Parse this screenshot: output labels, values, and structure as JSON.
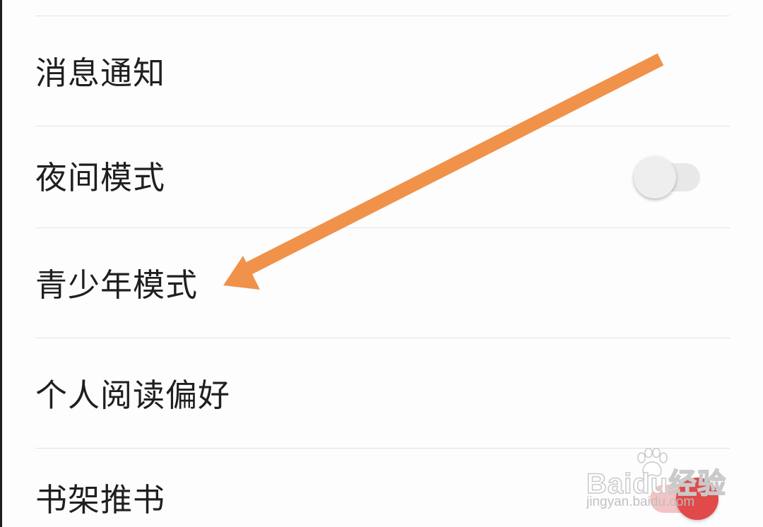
{
  "settings": {
    "items": [
      {
        "label": "消息通知"
      },
      {
        "label": "夜间模式",
        "toggle_on": false
      },
      {
        "label": "青少年模式"
      },
      {
        "label": "个人阅读偏好"
      },
      {
        "label": "书架推书"
      }
    ]
  },
  "watermark": {
    "brand": "Baidu经验",
    "url": "jingyan.baidu.com"
  },
  "colors": {
    "arrow": "#f0924a",
    "badge": "#e04a4a"
  }
}
